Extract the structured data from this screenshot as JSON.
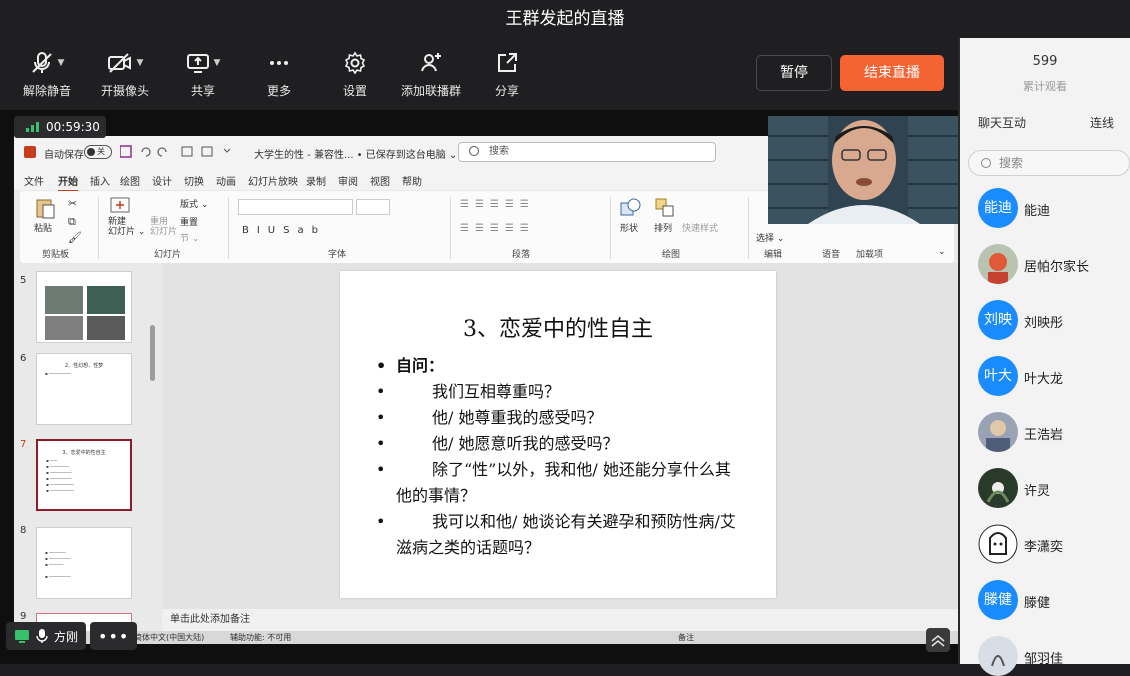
{
  "window": {
    "title": "王群发起的直播"
  },
  "toolbar": {
    "unmute": "解除静音",
    "camera": "开摄像头",
    "share": "共享",
    "more": "更多",
    "settings": "设置",
    "add_host": "添加联播群",
    "forward": "分享",
    "pause": "暂停",
    "end_live": "结束直播"
  },
  "stage": {
    "timer": "00:59:30",
    "presenter": "方刚"
  },
  "ppt": {
    "autosave": "自动保存",
    "autosave_state": "关",
    "doc_title": "大学生的性 - 兼容性... • 已保存到这台电脑 ⌄",
    "search": "搜索",
    "tabs": [
      "文件",
      "开始",
      "插入",
      "绘图",
      "设计",
      "切换",
      "动画",
      "幻灯片放映",
      "录制",
      "审阅",
      "视图",
      "帮助"
    ],
    "record": "录制",
    "ribbon": {
      "paste": "粘贴",
      "clipboard": "剪贴板",
      "new_slide": "新建\n幻灯片 ⌄",
      "reuse": "重用\n幻灯片",
      "layout": "版式 ⌄",
      "reset": "重置",
      "section": "节 ⌄",
      "slides_group": "幻灯片",
      "font_group": "字体",
      "paragraph_group": "段落",
      "shape": "形状",
      "arrange": "排列",
      "quick_style": "快速样式",
      "drawing_group": "绘图",
      "select": "选择 ⌄",
      "editing_group": "编辑",
      "voice_group": "语音",
      "addins_group": "加载项"
    },
    "thumbnails": [
      {
        "num": "5",
        "title": ""
      },
      {
        "num": "6",
        "title": "2、性幻想、性梦"
      },
      {
        "num": "7",
        "title": "3、恋爱中的性自主"
      },
      {
        "num": "8",
        "title": ""
      },
      {
        "num": "9",
        "title": ""
      }
    ],
    "slide": {
      "title": "3、恋爱中的性自主",
      "lead": "自问：",
      "bullets": [
        "我们互相尊重吗？",
        "他/ 她尊重我的感受吗？",
        "他/ 她愿意听我的感受吗？",
        "除了“性”以外，我和他/ 她还能分享什么其他的事情？",
        "我可以和他/ 她谈论有关避孕和预防性病/艾滋病之类的话题吗？"
      ]
    },
    "notes_placeholder": "单击此处添加备注",
    "status_lang": "简体中文(中国大陆)",
    "status_access": "辅助功能: 不可用",
    "status_notes": "备注"
  },
  "side": {
    "view_count": "599",
    "view_label": "累计观看",
    "tab_chat": "聊天互动",
    "tab_link": "连线",
    "search_placeholder": "搜索",
    "users": [
      {
        "avatar_text": "能迪",
        "name": "能迪",
        "photo": false
      },
      {
        "avatar_text": "",
        "name": "居帕尔家长",
        "photo": true
      },
      {
        "avatar_text": "刘映",
        "name": "刘映彤",
        "photo": false
      },
      {
        "avatar_text": "叶大",
        "name": "叶大龙",
        "photo": false
      },
      {
        "avatar_text": "",
        "name": "王浩岩",
        "photo": true
      },
      {
        "avatar_text": "",
        "name": "许灵",
        "photo": true
      },
      {
        "avatar_text": "",
        "name": "李潇奕",
        "photo": true
      },
      {
        "avatar_text": "滕健",
        "name": "滕健",
        "photo": false
      },
      {
        "avatar_text": "",
        "name": "邹羽佳",
        "photo": true
      }
    ]
  },
  "colors": {
    "accent": "#f56332",
    "avatar_blue": "#1a8cff",
    "ppt_red": "#c43e1c"
  }
}
